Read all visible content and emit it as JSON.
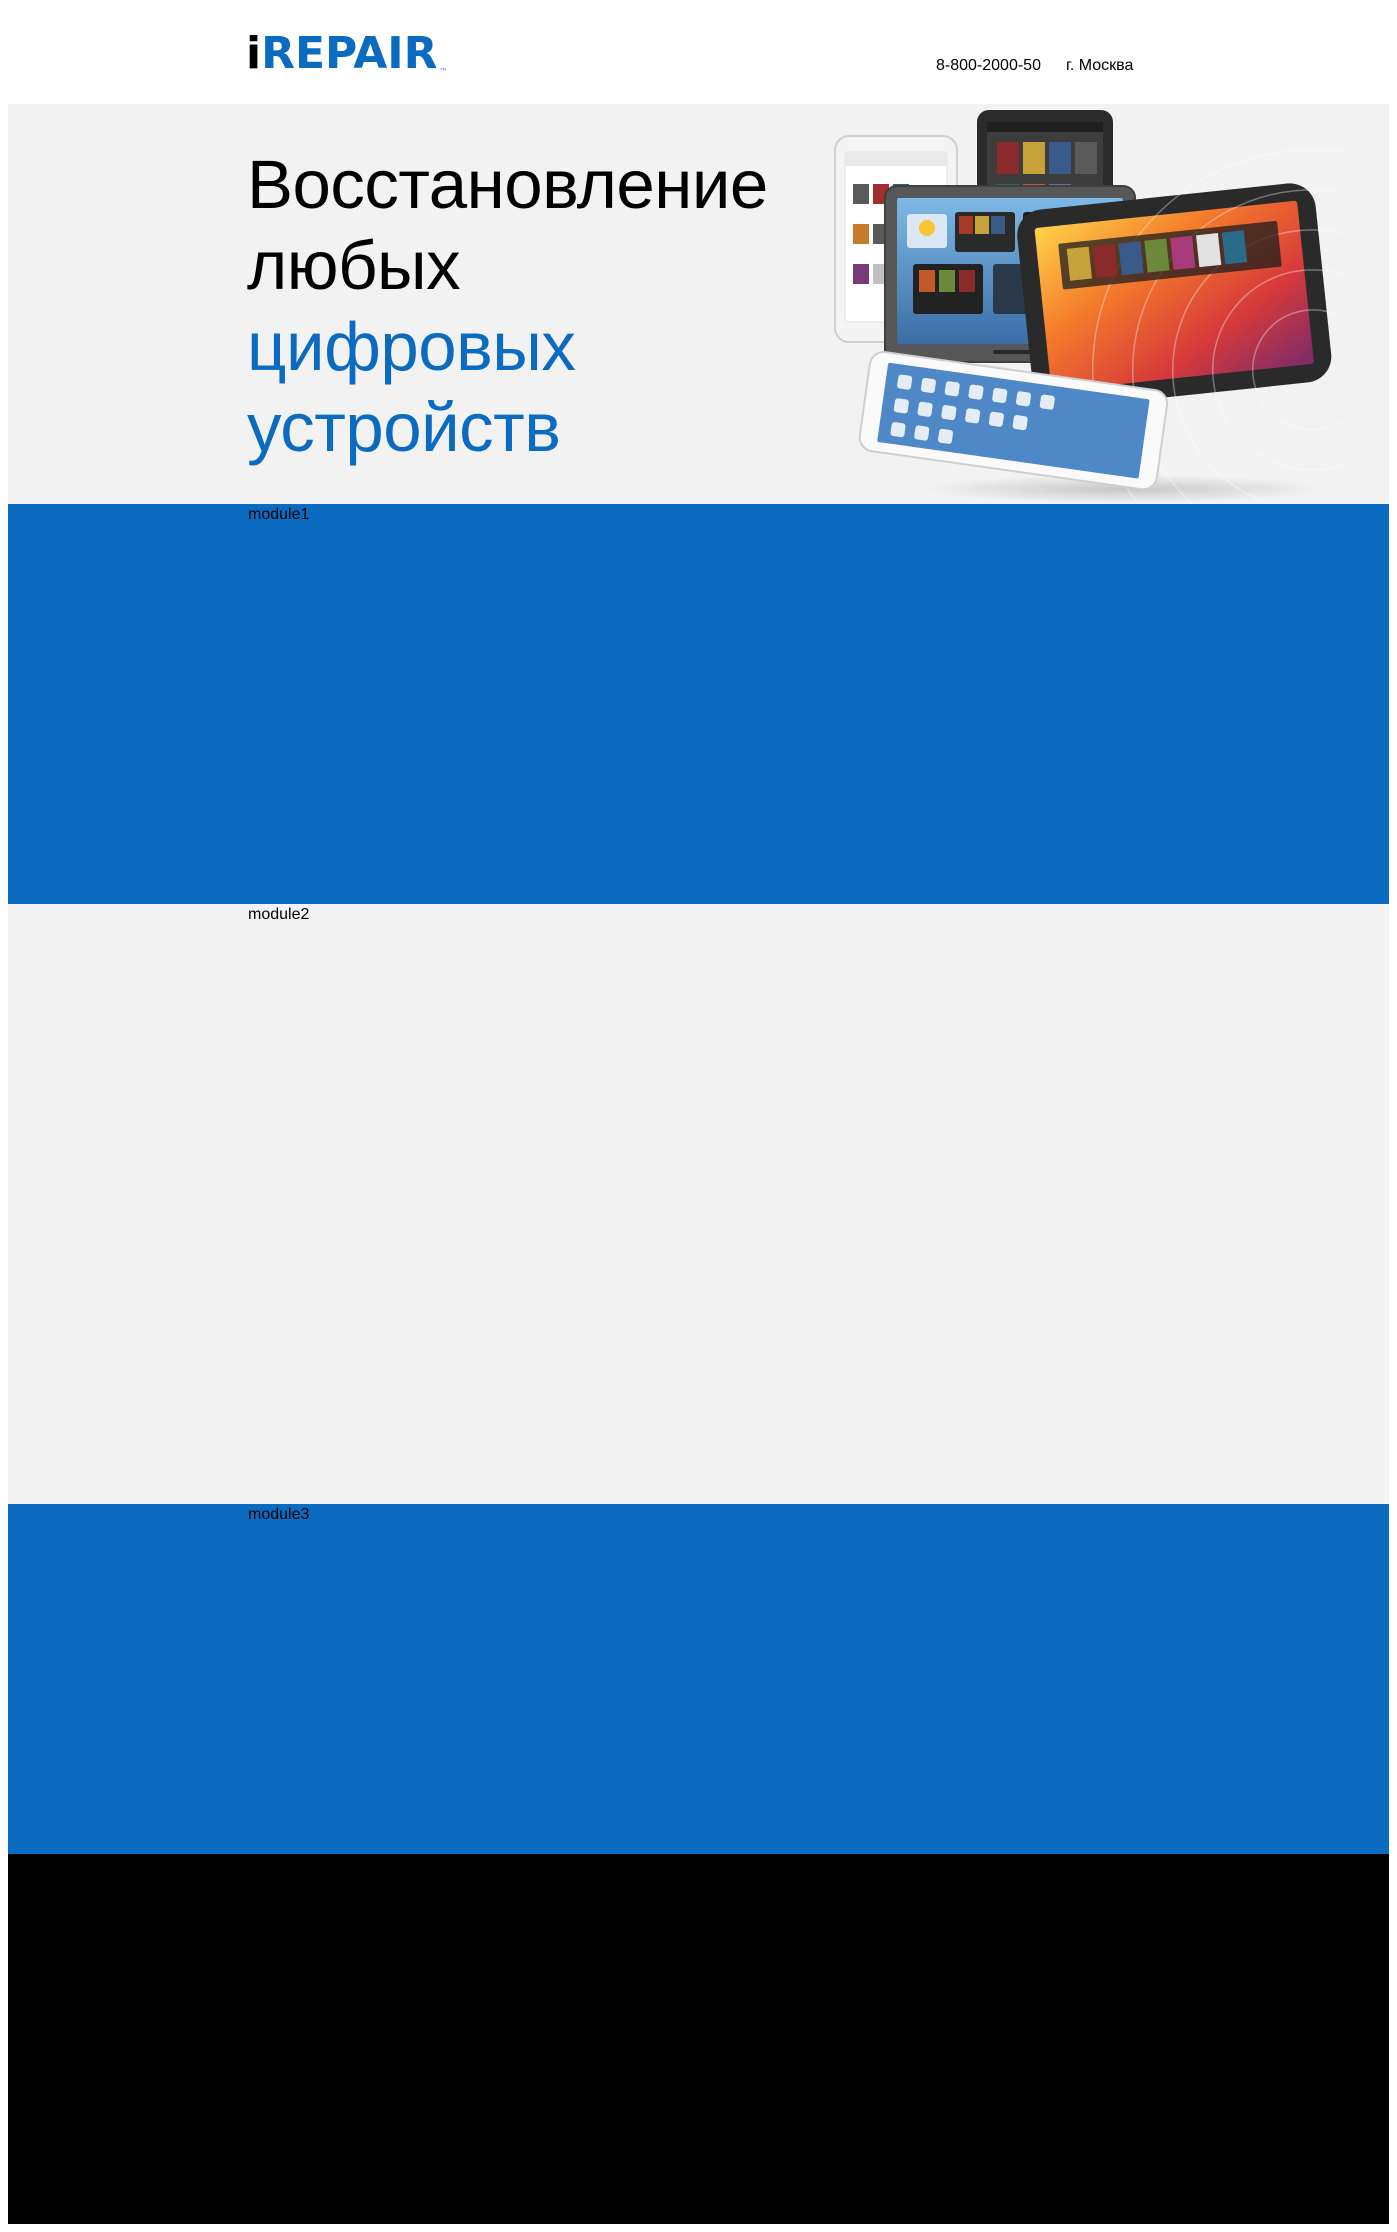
{
  "header": {
    "logo": {
      "i": "i",
      "rest": "REPAIR",
      "tm": "™"
    },
    "phone": "8-800-2000-50",
    "city": "г. Москва"
  },
  "hero": {
    "title_line1": "Восстановление",
    "title_line2": "любых",
    "title_line3": "цифровых",
    "title_line4": "устройств",
    "image_icon": "tablets-illustration"
  },
  "modules": [
    {
      "label": "module1",
      "color": "#0a6bc1"
    },
    {
      "label": "module2",
      "color": "#f3f3f3"
    },
    {
      "label": "module3",
      "color": "#0a6bc1"
    }
  ],
  "colors": {
    "brand_blue": "#0a6bc1",
    "hero_bg": "#f2f2f2",
    "footer_bg": "#000000"
  }
}
